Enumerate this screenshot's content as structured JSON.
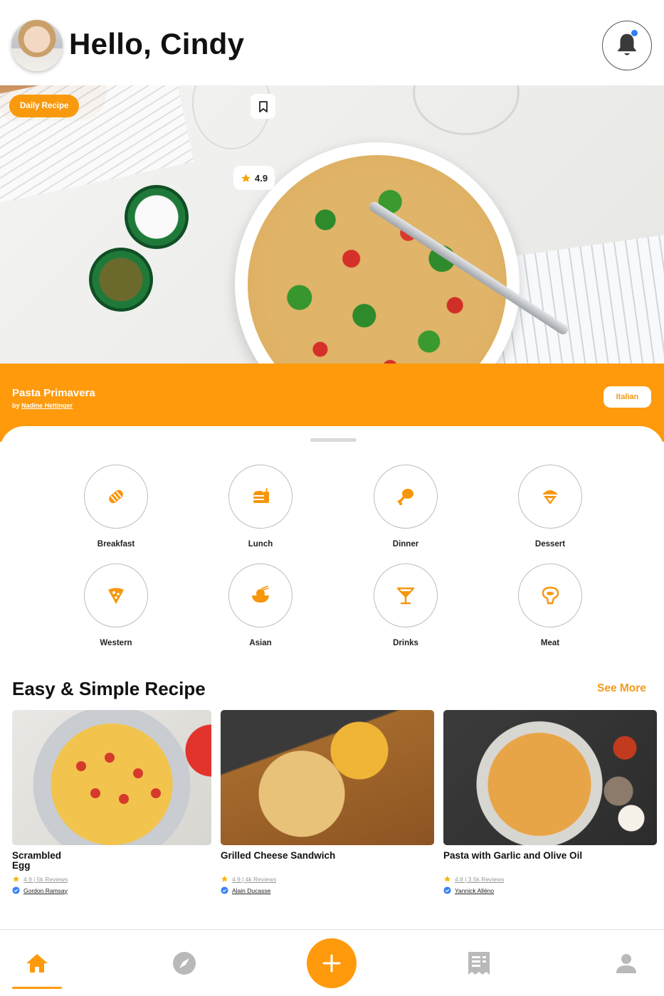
{
  "header": {
    "greeting": "Hello, Cindy",
    "has_notification": true
  },
  "hero": {
    "badge": "Daily Recipe",
    "rating": "4.9",
    "recipe_title": "Pasta Primavera",
    "by_prefix": "by",
    "author": "Nadine Hettinger",
    "cuisine": "Italian"
  },
  "categories": [
    {
      "label": "Breakfast",
      "icon": "bread-icon"
    },
    {
      "label": "Lunch",
      "icon": "burger-icon"
    },
    {
      "label": "Dinner",
      "icon": "chicken-leg-icon"
    },
    {
      "label": "Dessert",
      "icon": "ice-cream-icon"
    },
    {
      "label": "Western",
      "icon": "pizza-slice-icon"
    },
    {
      "label": "Asian",
      "icon": "rice-bowl-icon"
    },
    {
      "label": "Drinks",
      "icon": "cocktail-icon"
    },
    {
      "label": "Meat",
      "icon": "steak-icon"
    }
  ],
  "section": {
    "title": "Easy & Simple Recipe",
    "see_more": "See More"
  },
  "recipes": [
    {
      "title": "Scrambled\nEgg",
      "meta": "4.9 | 5k Reviews",
      "author": "Gordon Ramsay"
    },
    {
      "title": "Grilled Cheese Sandwich",
      "meta": "4.9 | 4k Reviews",
      "author": "Alain Ducasse"
    },
    {
      "title": "Pasta with Garlic and Olive Oil",
      "meta": "4.8 | 3.5k Reviews",
      "author": "Yannick Alléno"
    }
  ],
  "nav": {
    "items": [
      "home-icon",
      "compass-icon",
      "add-icon",
      "receipt-icon",
      "profile-icon"
    ],
    "active": "home-icon"
  },
  "colors": {
    "accent": "#ff9a0c",
    "star": "#f5b400",
    "verified": "#3b82f6"
  }
}
